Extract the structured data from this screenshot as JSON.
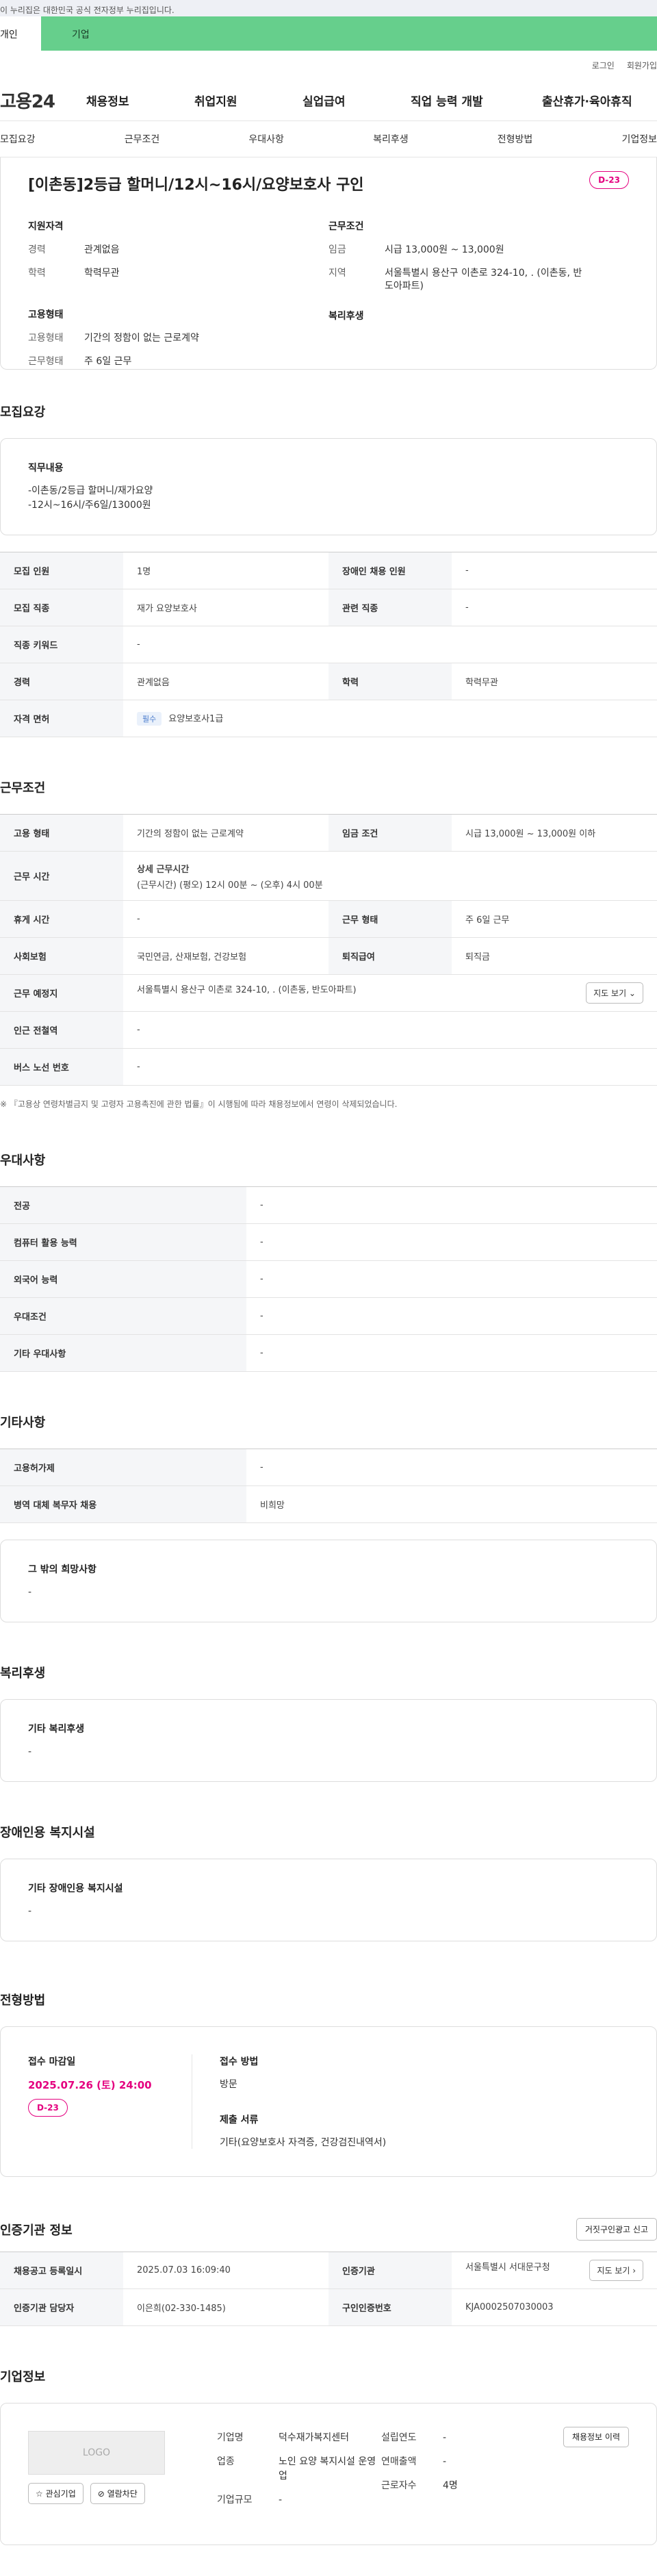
{
  "topbar": {
    "text": "이 누리집은 대한민국 공식 전자정부 누리집입니다."
  },
  "usertabs": {
    "individual": "개인",
    "company": "기업"
  },
  "util": {
    "login": "로그인",
    "join": "회원가입"
  },
  "gnb": {
    "logo": "고용24",
    "items": [
      "채용정보",
      "취업지원",
      "실업급여",
      "직업 능력 개발",
      "출산휴가·육아휴직"
    ]
  },
  "subnav": [
    "모집요강",
    "근무조건",
    "우대사항",
    "복리후생",
    "전형방법",
    "기업정보"
  ],
  "job": {
    "title": "[이촌동]2등급 할머니/12시~16시/요양보호사 구인",
    "dday": "D-23",
    "qual_head": "지원자격",
    "career_k": "경력",
    "career_v": "관계없음",
    "edu_k": "학력",
    "edu_v": "학력무관",
    "cond_head": "근무조건",
    "wage_k": "임금",
    "wage_v": "시급 13,000원 ~ 13,000원",
    "region_k": "지역",
    "region_v": "서울특별시 용산구 이촌로 324-10, . (이촌동, 반도아파트)",
    "emp_head": "고용형태",
    "emptype_k": "고용형태",
    "emptype_v": "기간의 정함이 없는 근로계약",
    "worktype_k": "근무형태",
    "worktype_v": "주 6일 근무",
    "welfare_head": "복리후생"
  },
  "recruit": {
    "title": "모집요강",
    "duty_head": "직무내용",
    "duty_body_1": "-이촌동/2등급 할머니/재가요양",
    "duty_body_2": "-12시~16시/주6일/13000원",
    "rows": {
      "count_k": "모집 인원",
      "count_v": "1명",
      "disabled_k": "장애인 채용 인원",
      "disabled_v": "-",
      "job_k": "모집 직종",
      "job_v": "재가 요양보호사",
      "rel_k": "관련 직종",
      "rel_v": "-",
      "kw_k": "직종 키워드",
      "kw_v": "-",
      "career_k": "경력",
      "career_v": "관계없음",
      "edu_k": "학력",
      "edu_v": "학력무관",
      "lic_k": "자격 면허",
      "lic_badge": "필수",
      "lic_v": "요양보호사1급"
    }
  },
  "work": {
    "title": "근무조건",
    "emptype_k": "고용 형태",
    "emptype_v": "기간의 정함이 없는 근로계약",
    "wage_k": "임금 조건",
    "wage_v": "시급 13,000원 ~ 13,000원 이하",
    "time_k": "근무 시간",
    "time_head": "상세 근무시간",
    "time_v": "(근무시간) (평오) 12시 00분 ~ (오후) 4시 00분",
    "rest_k": "휴게 시간",
    "rest_v": "-",
    "form_k": "근무 형태",
    "form_v": "주 6일 근무",
    "ins_k": "사회보험",
    "ins_v": "국민연금, 산재보험, 건강보험",
    "ret_k": "퇴직급여",
    "ret_v": "퇴직금",
    "place_k": "근무 예정지",
    "place_v": "서울특별시 용산구 이촌로 324-10, . (이촌동, 반도아파트)",
    "map_btn": "지도 보기 ⌄",
    "subway_k": "인근 전철역",
    "subway_v": "-",
    "bus_k": "버스 노선 번호",
    "bus_v": "-",
    "note": "※ 『고용상 연령차별금지 및 고령자 고용촉진에 관한 법률』이 시행됨에 따라 채용정보에서 연령이 삭제되었습니다."
  },
  "pref": {
    "title": "우대사항",
    "rows": [
      {
        "k": "전공",
        "v": "-"
      },
      {
        "k": "컴퓨터 활용 능력",
        "v": "-"
      },
      {
        "k": "외국어 능력",
        "v": "-"
      },
      {
        "k": "우대조건",
        "v": "-"
      },
      {
        "k": "기타 우대사항",
        "v": "-"
      }
    ]
  },
  "etc": {
    "title": "기타사항",
    "rows": [
      {
        "k": "고용허가제",
        "v": "-"
      },
      {
        "k": "병역 대체 복무자 채용",
        "v": "비희망"
      }
    ],
    "other_head": "그 밖의 희망사항",
    "other_v": "-"
  },
  "welfare": {
    "title": "복리후생",
    "head": "기타 복리후생",
    "v": "-"
  },
  "facility": {
    "title": "장애인용 복지시설",
    "head": "기타 장애인용 복지시설",
    "v": "-"
  },
  "process": {
    "title": "전형방법",
    "deadline_head": "접수 마감일",
    "deadline_v": "2025.07.26 (토) 24:00",
    "dday": "D-23",
    "method_head": "접수 방법",
    "method_v": "방문",
    "docs_head": "제출 서류",
    "docs_v": "기타(요양보호사 자격증,  건강검진내역서)"
  },
  "cert": {
    "title": "인증기관 정보",
    "report_btn": "거짓구인광고 신고",
    "reg_k": "채용공고 등록일시",
    "reg_v": "2025.07.03 16:09:40",
    "org_k": "인증기관",
    "org_v": "서울특별시 서대문구청",
    "map_btn": "지도 보기 ›",
    "mgr_k": "인증기관 담당자",
    "mgr_v": "이은희(02-330-1485)",
    "no_k": "구인인증번호",
    "no_v": "KJA0002507030003"
  },
  "corp": {
    "title": "기업정보",
    "logo": "LOGO",
    "fav_btn": "☆ 관심기업",
    "block_btn": "⊘ 열람차단",
    "name_k": "기업명",
    "name_v": "덕수재가복지센터",
    "biz_k": "업종",
    "biz_v": "노인 요양 복지시설 운영업",
    "size_k": "기업규모",
    "size_v": "-",
    "year_k": "설립연도",
    "year_v": "-",
    "sales_k": "연매출액",
    "sales_v": "-",
    "emp_k": "근로자수",
    "emp_v": "4명",
    "history_btn": "채용정보 이력"
  },
  "colors": {
    "accent_green": "#66cf8c",
    "dday_pink": "#e4007f"
  }
}
